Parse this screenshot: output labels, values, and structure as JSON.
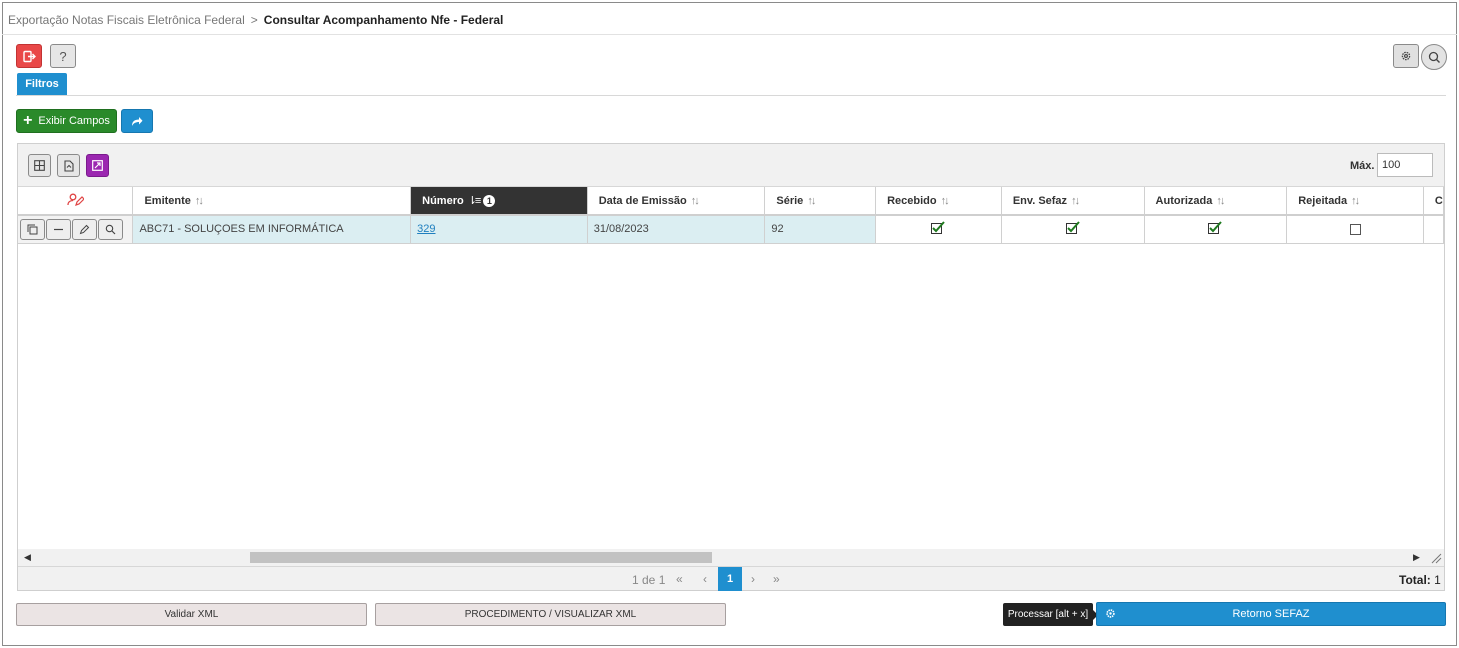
{
  "breadcrumb": {
    "parent": "Exportação Notas Fiscais Eletrônica Federal",
    "separator": ">",
    "current": "Consultar Acompanhamento Nfe - Federal"
  },
  "toolbar": {
    "help_label": "?",
    "filtros_tab": "Filtros",
    "exibir_campos_label": "Exibir Campos"
  },
  "grid": {
    "max_label": "Máx.",
    "max_value": "100",
    "columns": [
      {
        "label": "Emitente"
      },
      {
        "label": "Número"
      },
      {
        "label": "Data de Emissão"
      },
      {
        "label": "Série"
      },
      {
        "label": "Recebido"
      },
      {
        "label": "Env. Sefaz"
      },
      {
        "label": "Autorizada"
      },
      {
        "label": "Rejeitada"
      },
      {
        "label": "C"
      }
    ],
    "rows": [
      {
        "emitente": "ABC71 - SOLUÇOES EM INFORMÁTICA",
        "numero": "329",
        "data_emissao": "31/08/2023",
        "serie": "92",
        "recebido": true,
        "env_sefaz": true,
        "autorizada": true,
        "rejeitada": false
      }
    ],
    "pager": {
      "info": "1 de 1",
      "first": "«",
      "prev": "‹",
      "current_page": "1",
      "next": "›",
      "last": "»",
      "total_label": "Total:",
      "total_value": "1"
    }
  },
  "footer": {
    "validar_xml": "Validar XML",
    "procedimento": "PROCEDIMENTO / VISUALIZAR XML",
    "tooltip": "Processar [alt + x]",
    "retorno_sefaz": "Retorno SEFAZ"
  },
  "colors": {
    "primary_blue": "#1f8fcf",
    "exit_red": "#e94848",
    "success_green": "#2a8a2a",
    "purple": "#9b27b0",
    "selected_row": "#dbeef2"
  }
}
